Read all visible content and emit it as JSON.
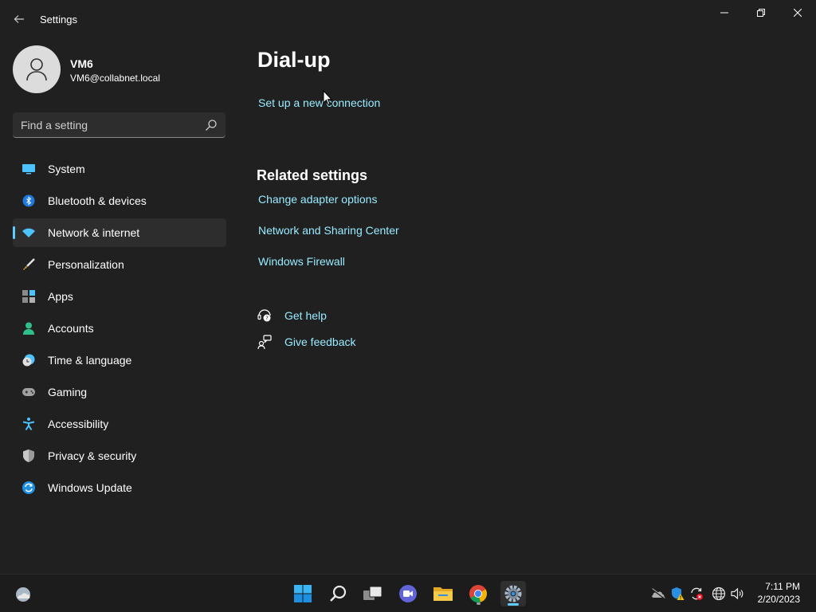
{
  "window": {
    "title": "Settings",
    "controls": {
      "minimize": "─",
      "maximize": "❐",
      "close": "✕"
    }
  },
  "user": {
    "name": "VM6",
    "email": "VM6@collabnet.local"
  },
  "search": {
    "placeholder": "Find a setting"
  },
  "sidebar": {
    "items": [
      {
        "label": "System",
        "icon": "monitor-icon"
      },
      {
        "label": "Bluetooth & devices",
        "icon": "bluetooth-icon"
      },
      {
        "label": "Network & internet",
        "icon": "wifi-icon",
        "active": true
      },
      {
        "label": "Personalization",
        "icon": "brush-icon"
      },
      {
        "label": "Apps",
        "icon": "apps-icon"
      },
      {
        "label": "Accounts",
        "icon": "person-icon"
      },
      {
        "label": "Time & language",
        "icon": "clock-globe-icon"
      },
      {
        "label": "Gaming",
        "icon": "gamepad-icon"
      },
      {
        "label": "Accessibility",
        "icon": "accessibility-icon"
      },
      {
        "label": "Privacy & security",
        "icon": "shield-icon"
      },
      {
        "label": "Windows Update",
        "icon": "update-icon"
      }
    ]
  },
  "main": {
    "title": "Dial-up",
    "setup_link": "Set up a new connection",
    "related_heading": "Related settings",
    "related_links": [
      "Change adapter options",
      "Network and Sharing Center",
      "Windows Firewall"
    ],
    "get_help": "Get help",
    "give_feedback": "Give feedback"
  },
  "taskbar": {
    "apps": [
      "weather-icon",
      "start-icon",
      "search-icon",
      "task-view-icon",
      "teams-chat-icon",
      "file-explorer-icon",
      "chrome-icon",
      "settings-icon"
    ],
    "tray": [
      "onedrive-icon",
      "security-warning-icon",
      "sync-error-icon",
      "network-globe-icon",
      "volume-icon"
    ],
    "time": "7:11 PM",
    "date": "2/20/2023"
  },
  "colors": {
    "background": "#202020",
    "accent": "#60cdff",
    "link": "#99ebff",
    "active_item": "#2d2d2d"
  }
}
